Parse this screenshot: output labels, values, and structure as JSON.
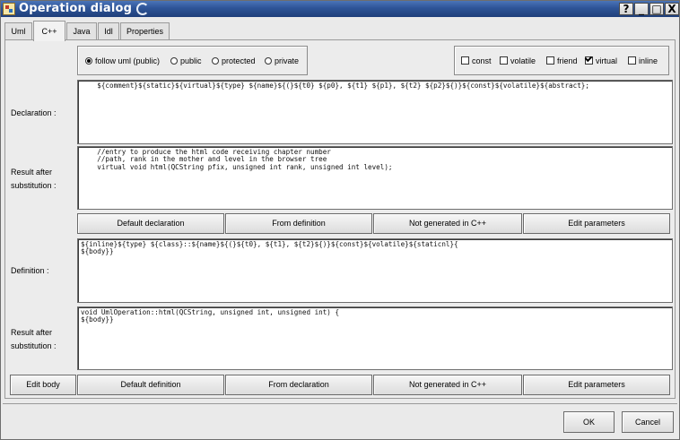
{
  "window": {
    "title": "Operation dialog"
  },
  "titlebar_buttons": {
    "help": "?",
    "minimize": "_",
    "maximize": "□",
    "close": "X"
  },
  "tabs": [
    {
      "label": "Uml"
    },
    {
      "label": "C++"
    },
    {
      "label": "Java"
    },
    {
      "label": "Idl"
    },
    {
      "label": "Properties"
    }
  ],
  "visibility": {
    "options": [
      "follow uml (public)",
      "public",
      "protected",
      "private"
    ],
    "selected": "follow uml (public)"
  },
  "modifiers": [
    {
      "label": "const",
      "checked": false
    },
    {
      "label": "volatile",
      "checked": false
    },
    {
      "label": "friend",
      "checked": false
    },
    {
      "label": "virtual",
      "checked": true
    },
    {
      "label": "inline",
      "checked": false
    }
  ],
  "labels": {
    "declaration": "Declaration :",
    "result_after_1": "Result after",
    "result_after_2": "substitution :",
    "definition": "Definition :"
  },
  "declaration": {
    "text": "    ${comment}${static}${virtual}${type} ${name}${(}${t0} ${p0}, ${t1} ${p1}, ${t2} ${p2}${)}${const}${volatile}${abstract};"
  },
  "declaration_result": {
    "text": "    //entry to produce the html code receiving chapter number\n    //path, rank in the mother and level in the browser tree\n    virtual void html(QCString pfix, unsigned int rank, unsigned int level);"
  },
  "declaration_buttons": {
    "default": "Default declaration",
    "from": "From definition",
    "not_generated": "Not generated in C++",
    "edit_params": "Edit parameters"
  },
  "definition": {
    "text": "${inline}${type} ${class}::${name}${(}${t0}, ${t1}, ${t2}${)}${const}${volatile}${staticnl}{\n${body}}"
  },
  "definition_result": {
    "text": "void UmlOperation::html(QCString, unsigned int, unsigned int) {\n${body}}"
  },
  "definition_buttons": {
    "edit_body": "Edit body",
    "default": "Default definition",
    "from": "From declaration",
    "not_generated": "Not generated in C++",
    "edit_params": "Edit parameters"
  },
  "footer": {
    "ok": "OK",
    "cancel": "Cancel"
  }
}
